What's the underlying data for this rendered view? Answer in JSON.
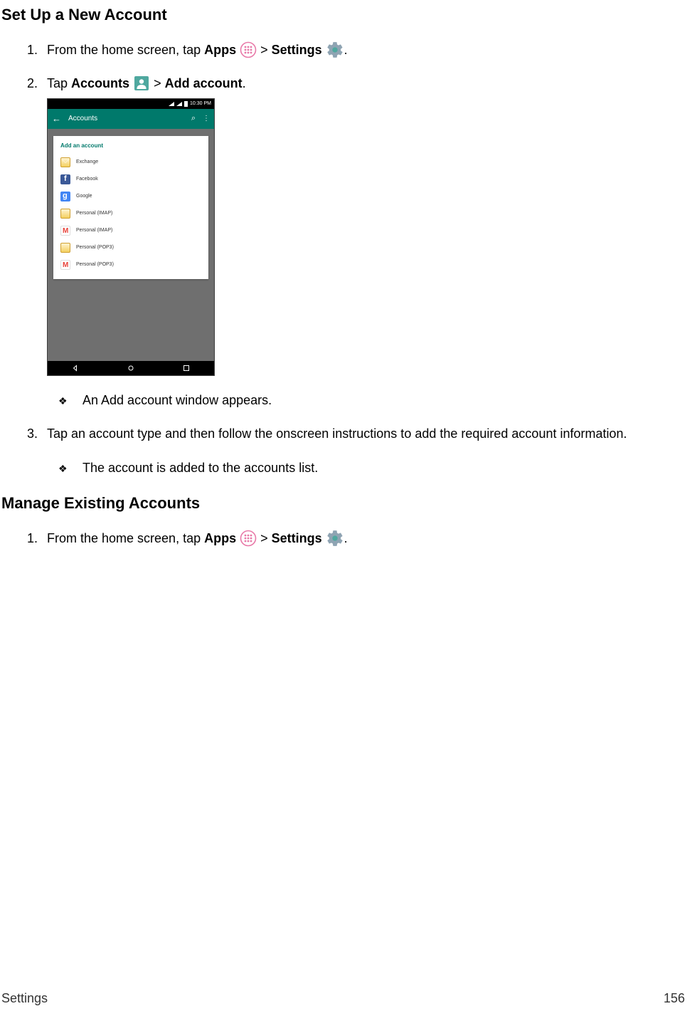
{
  "section1": {
    "heading": "Set Up a New Account",
    "steps": [
      {
        "prefix": "From the home screen, tap ",
        "bold1": "Apps",
        "mid1": " ",
        "sep1": " > ",
        "bold2": "Settings",
        "mid2": " ",
        "suffix": "."
      },
      {
        "prefix": "Tap ",
        "bold1": "Accounts",
        "mid1": " ",
        "sep1": " > ",
        "bold2": "Add account",
        "suffix": "."
      },
      {
        "text": "Tap an account type and then follow the onscreen instructions to add the required account information."
      }
    ],
    "bullets": [
      "An Add account window appears.",
      "The account is added to the accounts list."
    ]
  },
  "screenshot": {
    "statusbar_time": "10:30 PM",
    "appbar_title": "Accounts",
    "card_header": "Add an account",
    "items": [
      {
        "label": "Exchange",
        "icon": "exchange"
      },
      {
        "label": "Facebook",
        "icon": "facebook"
      },
      {
        "label": "Google",
        "icon": "google"
      },
      {
        "label": "Personal (IMAP)",
        "icon": "imap1"
      },
      {
        "label": "Personal (IMAP)",
        "icon": "gmail"
      },
      {
        "label": "Personal (POP3)",
        "icon": "imap1"
      },
      {
        "label": "Personal (POP3)",
        "icon": "gmail"
      }
    ]
  },
  "section2": {
    "heading": "Manage Existing Accounts",
    "steps": [
      {
        "prefix": "From the home screen, tap ",
        "bold1": "Apps",
        "mid1": " ",
        "sep1": " > ",
        "bold2": "Settings",
        "mid2": " ",
        "suffix": "."
      }
    ]
  },
  "footer": {
    "left": "Settings",
    "right": "156"
  }
}
